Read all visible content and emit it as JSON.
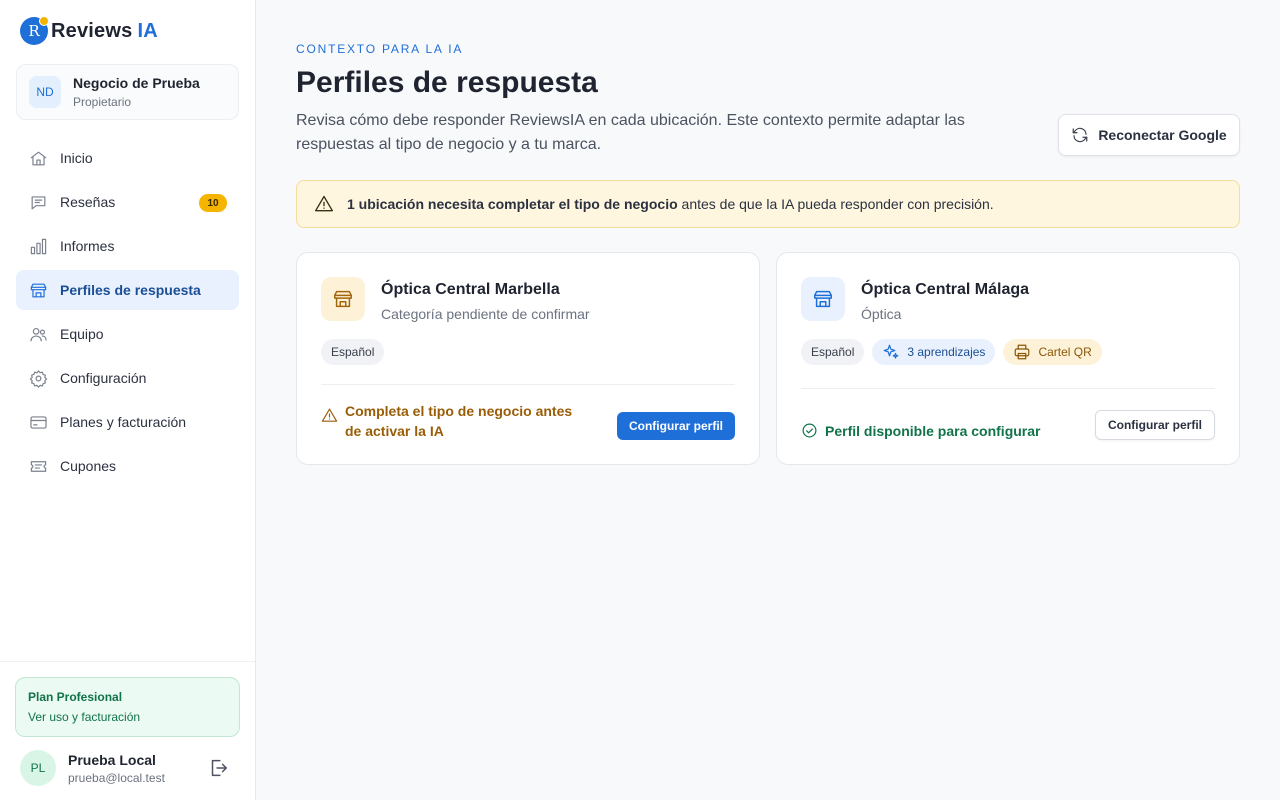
{
  "brand": {
    "name": "Reviews",
    "accent": "IA",
    "logo_letter": "R"
  },
  "business": {
    "initials": "ND",
    "name": "Negocio de Prueba",
    "role": "Propietario"
  },
  "nav": {
    "items": [
      {
        "label": "Inicio",
        "icon": "home-icon"
      },
      {
        "label": "Reseñas",
        "icon": "message-icon",
        "badge": "10"
      },
      {
        "label": "Informes",
        "icon": "bar-chart-icon"
      },
      {
        "label": "Perfiles de respuesta",
        "icon": "store-icon",
        "active": true
      },
      {
        "label": "Equipo",
        "icon": "users-icon"
      },
      {
        "label": "Configuración",
        "icon": "gear-icon"
      },
      {
        "label": "Planes y facturación",
        "icon": "credit-card-icon"
      },
      {
        "label": "Cupones",
        "icon": "ticket-icon"
      }
    ]
  },
  "plan": {
    "title": "Plan Profesional",
    "link": "Ver uso y facturación"
  },
  "user": {
    "initials": "PL",
    "name": "Prueba Local",
    "email": "prueba@local.test"
  },
  "header": {
    "eyebrow": "CONTEXTO PARA LA IA",
    "title": "Perfiles de respuesta",
    "description": "Revisa cómo debe responder ReviewsIA en cada ubicación. Este contexto permite adaptar las respuestas al tipo de negocio y a tu marca.",
    "reconnect_label": "Reconectar Google"
  },
  "alert": {
    "bold": "1 ubicación necesita completar el tipo de negocio",
    "text": " antes de que la IA pueda responder con precisión."
  },
  "locations": [
    {
      "name": "Óptica Central Marbella",
      "category": "Categoría pendiente de confirmar",
      "chips": {
        "language": "Español"
      },
      "status": "Completa el tipo de negocio antes de activar la IA",
      "button": "Configurar perfil"
    },
    {
      "name": "Óptica Central Málaga",
      "category": "Óptica",
      "chips": {
        "language": "Español",
        "learnings": "3 aprendizajes",
        "qr": "Cartel QR"
      },
      "status": "Perfil disponible para configurar",
      "button": "Configurar perfil"
    }
  ],
  "colors": {
    "accent": "#1f6fd9",
    "warning": "#f5b400",
    "success": "#11734a"
  }
}
